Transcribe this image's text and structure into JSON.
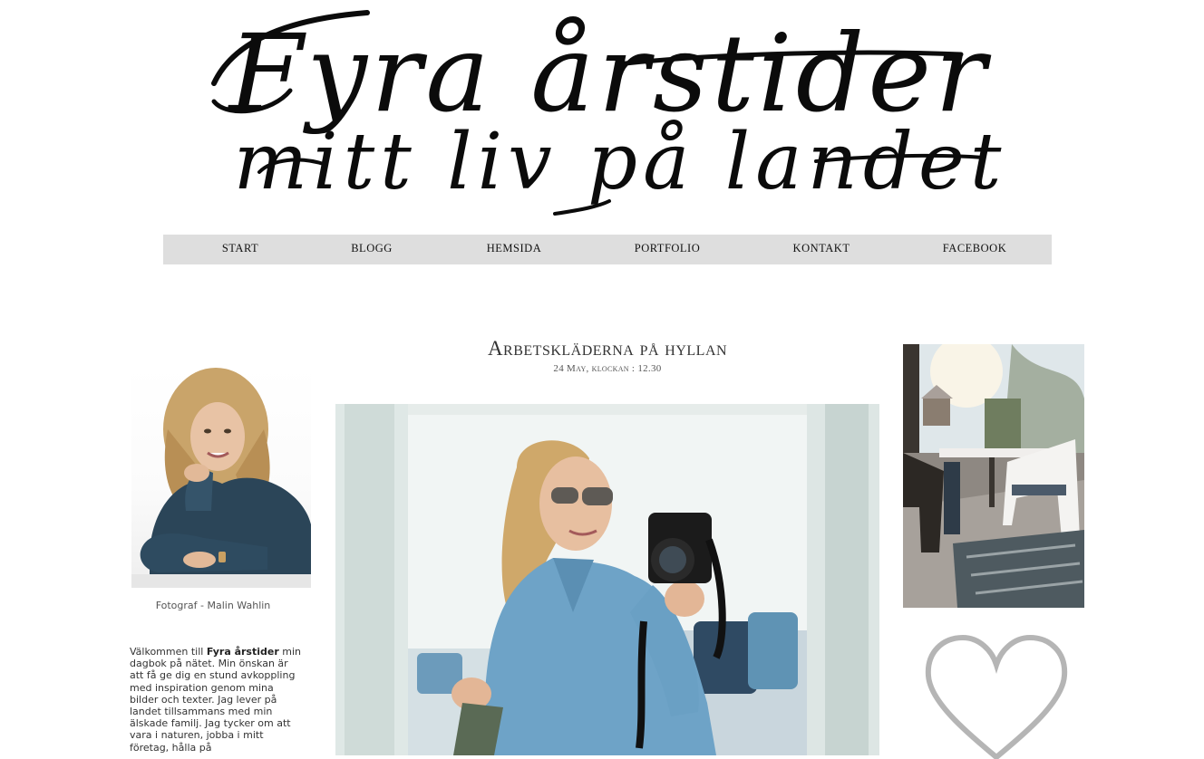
{
  "header": {
    "title_line1": "Fyra årstider",
    "title_line2": "mitt liv på landet"
  },
  "nav": {
    "items": [
      {
        "label": "START"
      },
      {
        "label": "BLOGG"
      },
      {
        "label": "HEMSIDA"
      },
      {
        "label": "PORTFOLIO"
      },
      {
        "label": "KONTAKT"
      },
      {
        "label": "FACEBOOK"
      }
    ]
  },
  "sidebar": {
    "photo_caption": "Fotograf - Malin Wahlin",
    "welcome": {
      "prefix": "Välkommen till ",
      "blog_name": "Fyra årstider",
      "text": "min dagbok på nätet. Min önskan är att få ge dig en stund avkoppling med inspiration genom mina bilder och texter. Jag lever på landet tillsammans med min älskade familj. Jag tycker om att vara i naturen, jobba i mitt företag, hålla på"
    }
  },
  "post": {
    "title": "Arbetskläderna på hyllan",
    "date": "24 May, klockan : 12.30"
  },
  "colors": {
    "nav_background": "#dedede",
    "heart_stroke": "#b5b5b5",
    "logo": "#0b0b0b"
  },
  "icons": {
    "heart": "heart-icon"
  }
}
